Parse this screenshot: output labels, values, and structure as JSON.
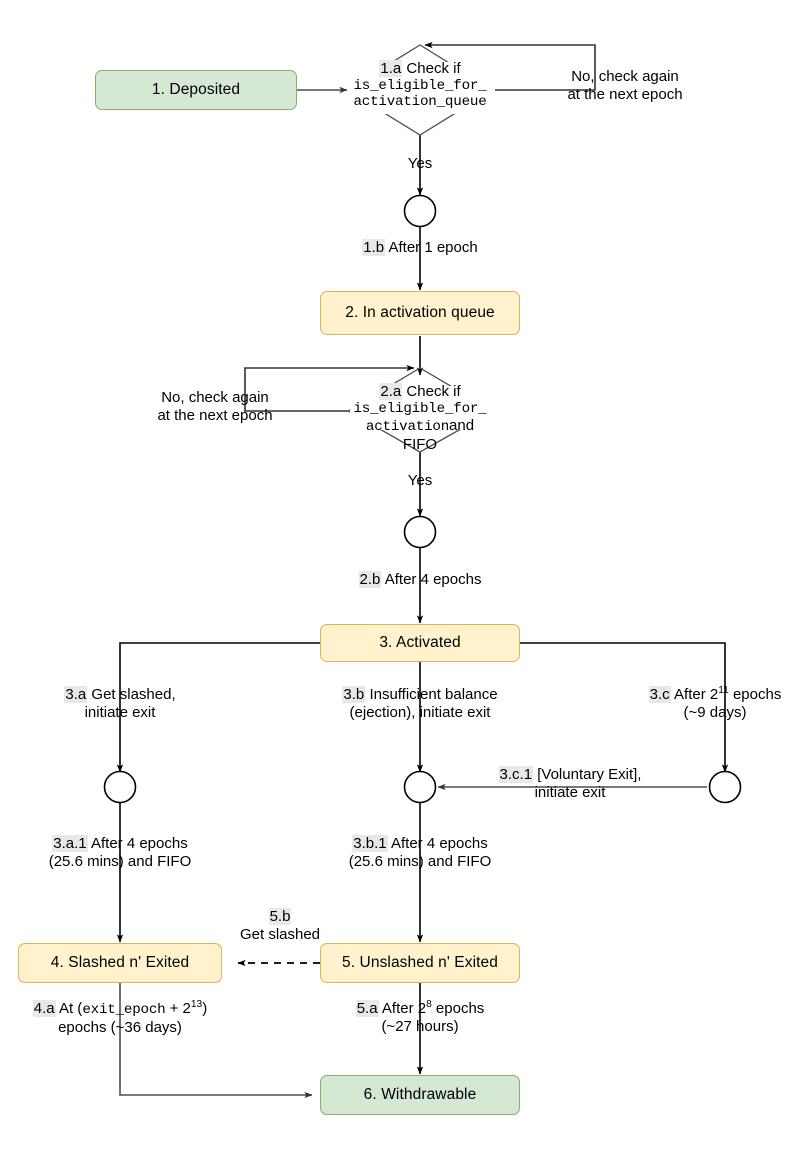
{
  "diagram": {
    "title": "Ethereum validator lifecycle state diagram",
    "colors": {
      "green_fill": "#d5e8d4",
      "green_border": "#82b366",
      "yellow_fill": "#fff2cc",
      "yellow_border": "#d6b656",
      "line": "#4d4d4d",
      "text": "#000000",
      "tag_highlight": "#e8e8e8"
    }
  },
  "nodes": [
    {
      "id": "deposited",
      "label": "1. Deposited",
      "style": "green"
    },
    {
      "id": "activation_queue",
      "label": "2. In activation queue",
      "style": "yellow"
    },
    {
      "id": "activated",
      "label": "3. Activated",
      "style": "yellow"
    },
    {
      "id": "slashed_exited",
      "label": "4. Slashed n' Exited",
      "style": "yellow"
    },
    {
      "id": "unslashed_exited",
      "label": "5. Unslashed n' Exited",
      "style": "yellow"
    },
    {
      "id": "withdrawable",
      "label": "6. Withdrawable",
      "style": "green"
    }
  ],
  "decisions": {
    "d1": {
      "tag": "1.a",
      "line1": "Check if",
      "code1": "is_eligible_for_",
      "code2": "activation_queue",
      "yes": "Yes",
      "no_line1": "No, check again",
      "no_line2": "at the next epoch"
    },
    "d2": {
      "tag": "2.a",
      "line1": "Check if",
      "code1": "is_eligible_for_",
      "code2": "activation",
      "and": "and",
      "line3": "FIFO",
      "yes": "Yes",
      "no_line1": "No, check again",
      "no_line2": "at the next epoch"
    }
  },
  "edges": {
    "e1b": {
      "tag": "1.b",
      "text": "After 1 epoch"
    },
    "e2b": {
      "tag": "2.b",
      "text": "After 4 epochs"
    },
    "e3a": {
      "tag": "3.a",
      "line1": "Get slashed,",
      "line2": "initiate exit"
    },
    "e3b": {
      "tag": "3.b",
      "line1": "Insufficient balance",
      "line2": "(ejection), initiate exit"
    },
    "e3c": {
      "tag": "3.c",
      "line1_pre": "After 2",
      "line1_sup": "11",
      "line1_post": " epochs",
      "line2": "(~9 days)"
    },
    "e3c1": {
      "tag": "3.c.1",
      "line1": "[Voluntary Exit],",
      "line2": "initiate exit"
    },
    "e3a1": {
      "tag": "3.a.1",
      "line1": "After 4 epochs",
      "line2": "(25.6 mins) and FIFO"
    },
    "e3b1": {
      "tag": "3.b.1",
      "line1": "After 4 epochs",
      "line2": "(25.6 mins) and FIFO"
    },
    "e5b": {
      "tag": "5.b",
      "line1": "Get slashed"
    },
    "e4a": {
      "tag": "4.a",
      "at": "At (",
      "code": "exit_epoch",
      "plus": " + 2",
      "sup": "13",
      "close": ")",
      "line2": "epochs (~36 days)"
    },
    "e5a": {
      "tag": "5.a",
      "pre": "After 2",
      "sup": "8",
      "post": " epochs",
      "line2": "(~27 hours)"
    }
  }
}
